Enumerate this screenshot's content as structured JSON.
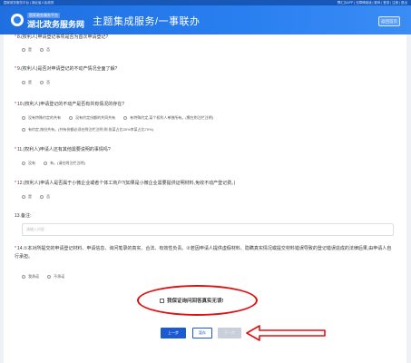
{
  "topbar": {
    "left": "国家政务服务平台 | 湖北省人民政府",
    "right": "鄂汇办APP | 无障碍阅读 | 繁体 | 登录 | 注册 | 退出"
  },
  "header": {
    "logo_small": "国家政务服务平台",
    "logo_main": "湖北政务服务网",
    "title": "主题集成服务/一事联办",
    "back_label": "返回首页"
  },
  "questions": {
    "q8": {
      "label": "8.(权利人)申请登记事项是否为首次申请登记?",
      "options": [
        "是",
        "否"
      ]
    },
    "q9": {
      "label": "9.(权利人)是否对申请登记的不动产情况全面了解?",
      "options": [
        "是",
        "否"
      ]
    },
    "q10": {
      "label": "10.(权利人)申请登记的不动产是否有共有情况的存在?",
      "options_row1": [
        "没有特殊约定的共有",
        "没有约定份额的共同共有",
        "有特殊约定,某个权利人单独所有。(需在附注栏注明)"
      ],
      "options_row2": [
        "有约定,按份共有。(共有份额必须在附注栏注明,例:张某占比30%李某占比70%)"
      ]
    },
    "q11": {
      "label": "11.(权利人)申请人还有其他需要说明的事情吗?",
      "options": [
        "没有",
        "有。(请在附注栏注明)"
      ]
    },
    "q12": {
      "label": "12.(权利人)申请人是否属于小微企业或者个体工商户?(如果是小微企业需要提供证明材料,免收不动产登记费。)",
      "options": [
        "是",
        "否"
      ]
    },
    "q13": {
      "label": "13.备注:",
      "placeholder": "请输入内容"
    },
    "q14": {
      "label": "14.①本对所提交的申请登记材料、申请信息、询问笔录的真实、合法、有效性负责。②若因申请人提供虚假材料、隐瞒真实情况或提交材料错误导致的登记错误造成的法律后果,由申请人自行承担。",
      "options": [
        "我承诺",
        "不承诺"
      ]
    }
  },
  "confirm_label": "我保证询问回答真实无误!",
  "buttons": {
    "prev": "上一步",
    "save": "暂存",
    "next": "下一步"
  },
  "colors": {
    "primary": "#1b5ad2",
    "highlight": "#e01010"
  }
}
